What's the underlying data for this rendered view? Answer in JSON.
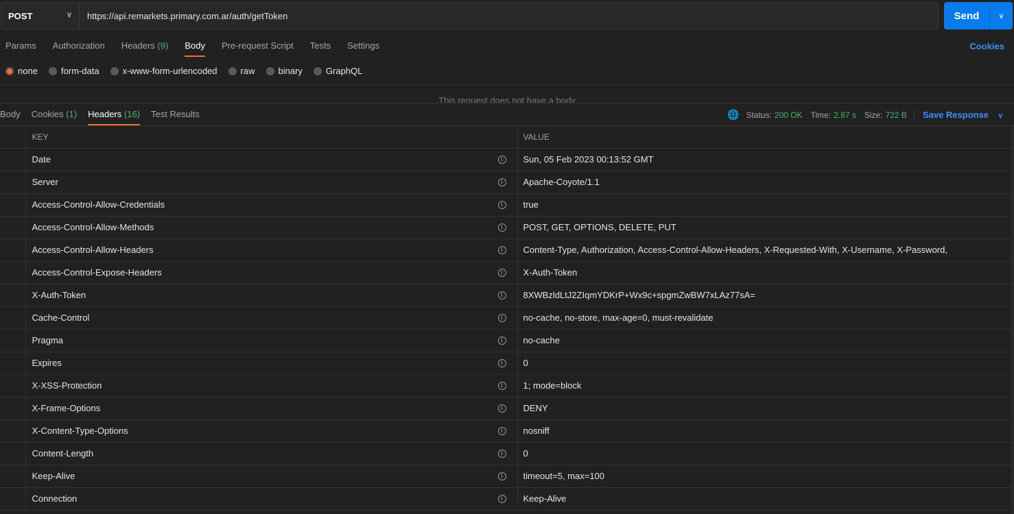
{
  "request": {
    "method": "POST",
    "url": "https://api.remarkets.primary.com.ar/auth/getToken",
    "send_label": "Send"
  },
  "req_tabs": [
    {
      "label": "Params"
    },
    {
      "label": "Authorization"
    },
    {
      "label": "Headers",
      "count": "(9)"
    },
    {
      "label": "Body",
      "active": true
    },
    {
      "label": "Pre-request Script"
    },
    {
      "label": "Tests"
    },
    {
      "label": "Settings"
    }
  ],
  "cookies_link": "Cookies",
  "body_types": [
    {
      "label": "none",
      "selected": true
    },
    {
      "label": "form-data"
    },
    {
      "label": "x-www-form-urlencoded"
    },
    {
      "label": "raw"
    },
    {
      "label": "binary"
    },
    {
      "label": "GraphQL"
    }
  ],
  "no_body_text": "This request does not have a body",
  "resp_tabs": [
    {
      "label": "Body"
    },
    {
      "label": "Cookies",
      "count": "(1)"
    },
    {
      "label": "Headers",
      "count": "(16)",
      "active": true
    },
    {
      "label": "Test Results"
    }
  ],
  "status": {
    "status_label": "Status:",
    "status": "200 OK",
    "time_label": "Time:",
    "time": "2.87 s",
    "size_label": "Size:",
    "size": "722 B",
    "save_label": "Save Response"
  },
  "colors": {
    "accent": "#f26b3a",
    "send": "#097bed",
    "link": "#3e8ef7",
    "success": "#49b870"
  },
  "headers_table": {
    "columns": [
      "KEY",
      "VALUE"
    ],
    "rows": [
      [
        "Date",
        "Sun, 05 Feb 2023 00:13:52 GMT"
      ],
      [
        "Server",
        "Apache-Coyote/1.1"
      ],
      [
        "Access-Control-Allow-Credentials",
        "true"
      ],
      [
        "Access-Control-Allow-Methods",
        "POST, GET, OPTIONS, DELETE, PUT"
      ],
      [
        "Access-Control-Allow-Headers",
        "Content-Type, Authorization, Access-Control-Allow-Headers, X-Requested-With, X-Username, X-Password,"
      ],
      [
        "Access-Control-Expose-Headers",
        "X-Auth-Token"
      ],
      [
        "X-Auth-Token",
        "8XWBzldLtJ2ZIqmYDKrP+Wx9c+spgmZwBW7xLAz77sA="
      ],
      [
        "Cache-Control",
        "no-cache, no-store, max-age=0, must-revalidate"
      ],
      [
        "Pragma",
        "no-cache"
      ],
      [
        "Expires",
        "0"
      ],
      [
        "X-XSS-Protection",
        "1; mode=block"
      ],
      [
        "X-Frame-Options",
        "DENY"
      ],
      [
        "X-Content-Type-Options",
        "nosniff"
      ],
      [
        "Content-Length",
        "0"
      ],
      [
        "Keep-Alive",
        "timeout=5, max=100"
      ],
      [
        "Connection",
        "Keep-Alive"
      ]
    ]
  }
}
